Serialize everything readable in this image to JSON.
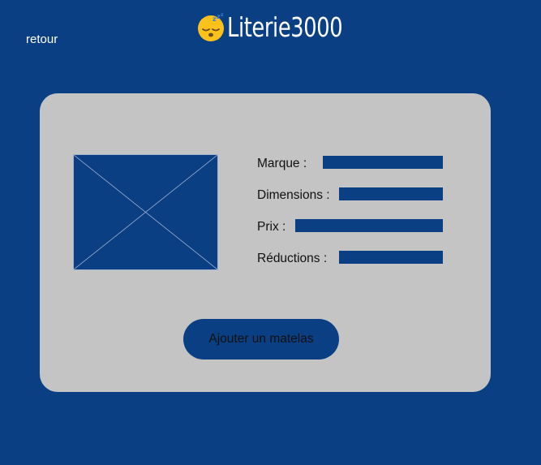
{
  "nav": {
    "back_label": "retour"
  },
  "brand": {
    "logo_icon": "sleeping-face-emoji",
    "name": "Literie3000"
  },
  "form": {
    "image_placeholder_icon": "image-placeholder-icon",
    "fields": [
      {
        "label": "Marque :",
        "value": ""
      },
      {
        "label": "Dimensions :",
        "value": ""
      },
      {
        "label": "Prix :",
        "value": ""
      },
      {
        "label": "Réductions :",
        "value": ""
      }
    ],
    "submit_label": "Ajouter un matelas"
  },
  "colors": {
    "background": "#0b3f83",
    "card": "#c4c4c4",
    "accent": "#0b3f83",
    "text_light": "#ffffff",
    "text_dark": "#111111"
  }
}
